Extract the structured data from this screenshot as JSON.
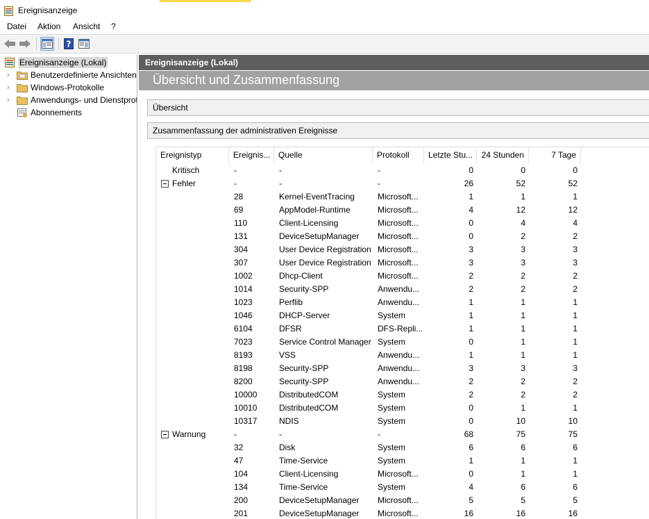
{
  "window": {
    "title": "Ereignisanzeige"
  },
  "menu": [
    "Datei",
    "Aktion",
    "Ansicht",
    "?"
  ],
  "toolbar": {
    "icons": [
      "back-arrow-icon",
      "forward-arrow-icon",
      "console-tree-icon",
      "help-icon",
      "view-icon"
    ]
  },
  "tree": {
    "root": "Ereignisanzeige (Lokal)",
    "items": [
      {
        "label": "Benutzerdefinierte Ansichten"
      },
      {
        "label": "Windows-Protokolle"
      },
      {
        "label": "Anwendungs- und Dienstprotokolle"
      },
      {
        "label": "Abonnements"
      }
    ]
  },
  "pane": {
    "header": "Ereignisanzeige (Lokal)",
    "subheader": "Übersicht und Zusammenfassung",
    "section_overview": "Übersicht",
    "section_summary": "Zusammenfassung der administrativen Ereignisse"
  },
  "table": {
    "columns": [
      "Ereignistyp",
      "Ereignis...",
      "Quelle",
      "Protokoll",
      "Letzte Stu...",
      "24 Stunden",
      "7 Tage"
    ],
    "rows": [
      {
        "group": false,
        "type": "Kritisch",
        "id": "-",
        "source": "-",
        "log": "-",
        "hour": "0",
        "day": "0",
        "week": "0"
      },
      {
        "group": true,
        "type": "Fehler",
        "id": "-",
        "source": "-",
        "log": "-",
        "hour": "26",
        "day": "52",
        "week": "52"
      },
      {
        "type": "",
        "id": "28",
        "source": "Kernel-EventTracing",
        "log": "Microsoft...",
        "hour": "1",
        "day": "1",
        "week": "1"
      },
      {
        "type": "",
        "id": "69",
        "source": "AppModel-Runtime",
        "log": "Microsoft...",
        "hour": "4",
        "day": "12",
        "week": "12"
      },
      {
        "type": "",
        "id": "110",
        "source": "Client-Licensing",
        "log": "Microsoft...",
        "hour": "0",
        "day": "4",
        "week": "4"
      },
      {
        "type": "",
        "id": "131",
        "source": "DeviceSetupManager",
        "log": "Microsoft...",
        "hour": "0",
        "day": "2",
        "week": "2"
      },
      {
        "type": "",
        "id": "304",
        "source": "User Device Registration",
        "log": "Microsoft...",
        "hour": "3",
        "day": "3",
        "week": "3"
      },
      {
        "type": "",
        "id": "307",
        "source": "User Device Registration",
        "log": "Microsoft...",
        "hour": "3",
        "day": "3",
        "week": "3"
      },
      {
        "type": "",
        "id": "1002",
        "source": "Dhcp-Client",
        "log": "Microsoft...",
        "hour": "2",
        "day": "2",
        "week": "2"
      },
      {
        "type": "",
        "id": "1014",
        "source": "Security-SPP",
        "log": "Anwendu...",
        "hour": "2",
        "day": "2",
        "week": "2"
      },
      {
        "type": "",
        "id": "1023",
        "source": "Perflib",
        "log": "Anwendu...",
        "hour": "1",
        "day": "1",
        "week": "1"
      },
      {
        "type": "",
        "id": "1046",
        "source": "DHCP-Server",
        "log": "System",
        "hour": "1",
        "day": "1",
        "week": "1"
      },
      {
        "type": "",
        "id": "6104",
        "source": "DFSR",
        "log": "DFS-Repli...",
        "hour": "1",
        "day": "1",
        "week": "1"
      },
      {
        "type": "",
        "id": "7023",
        "source": "Service Control Manager",
        "log": "System",
        "hour": "0",
        "day": "1",
        "week": "1"
      },
      {
        "type": "",
        "id": "8193",
        "source": "VSS",
        "log": "Anwendu...",
        "hour": "1",
        "day": "1",
        "week": "1"
      },
      {
        "type": "",
        "id": "8198",
        "source": "Security-SPP",
        "log": "Anwendu...",
        "hour": "3",
        "day": "3",
        "week": "3"
      },
      {
        "type": "",
        "id": "8200",
        "source": "Security-SPP",
        "log": "Anwendu...",
        "hour": "2",
        "day": "2",
        "week": "2"
      },
      {
        "type": "",
        "id": "10000",
        "source": "DistributedCOM",
        "log": "System",
        "hour": "2",
        "day": "2",
        "week": "2"
      },
      {
        "type": "",
        "id": "10010",
        "source": "DistributedCOM",
        "log": "System",
        "hour": "0",
        "day": "1",
        "week": "1"
      },
      {
        "type": "",
        "id": "10317",
        "source": "NDIS",
        "log": "System",
        "hour": "0",
        "day": "10",
        "week": "10"
      },
      {
        "group": true,
        "type": "Warnung",
        "id": "-",
        "source": "-",
        "log": "-",
        "hour": "68",
        "day": "75",
        "week": "75"
      },
      {
        "type": "",
        "id": "32",
        "source": "Disk",
        "log": "System",
        "hour": "6",
        "day": "6",
        "week": "6"
      },
      {
        "type": "",
        "id": "47",
        "source": "Time-Service",
        "log": "System",
        "hour": "1",
        "day": "1",
        "week": "1"
      },
      {
        "type": "",
        "id": "104",
        "source": "Client-Licensing",
        "log": "Microsoft...",
        "hour": "0",
        "day": "1",
        "week": "1"
      },
      {
        "type": "",
        "id": "134",
        "source": "Time-Service",
        "log": "System",
        "hour": "4",
        "day": "6",
        "week": "6"
      },
      {
        "type": "",
        "id": "200",
        "source": "DeviceSetupManager",
        "log": "Microsoft...",
        "hour": "5",
        "day": "5",
        "week": "5"
      },
      {
        "type": "",
        "id": "201",
        "source": "DeviceSetupManager",
        "log": "Microsoft...",
        "hour": "16",
        "day": "16",
        "week": "16"
      }
    ]
  },
  "colors": {
    "pane_header": "#5e5e5e",
    "pane_subheader": "#a1a1a1",
    "title_accent": "#f7d84a"
  }
}
